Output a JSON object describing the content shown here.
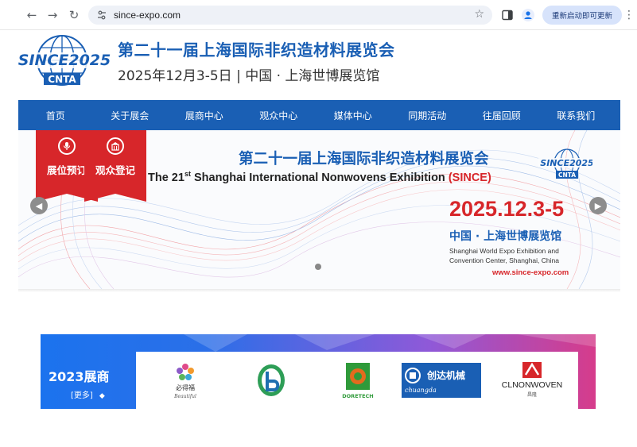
{
  "browser": {
    "url": "since-expo.com",
    "restart_label": "重新启动即可更新"
  },
  "header": {
    "logo_text_top": "SINCE2025",
    "logo_text_bottom": "CNTA",
    "title": "第二十一届上海国际非织造材料展览会",
    "subtitle": "2025年12月3-5日 | 中国 · 上海世博展览馆"
  },
  "nav": {
    "items": [
      {
        "label": "首页"
      },
      {
        "label": "关于展会"
      },
      {
        "label": "展商中心"
      },
      {
        "label": "观众中心"
      },
      {
        "label": "媒体中心"
      },
      {
        "label": "同期活动"
      },
      {
        "label": "往届回顾"
      },
      {
        "label": "联系我们"
      }
    ]
  },
  "banner": {
    "ribbons": [
      {
        "label": "展位预订"
      },
      {
        "label": "观众登记"
      }
    ],
    "title_cn": "第二十一届上海国际非织造材料展览会",
    "title_en_pre": "The 21",
    "title_en_sup": "st",
    "title_en_main": " Shanghai International Nonwovens Exhibition ",
    "title_en_since": "(SINCE)",
    "logo_text": "SINCE2025",
    "logo_sub": "CNTA",
    "date": "2025.12.3-5",
    "venue_cn": "中国 · 上海世博展览馆",
    "venue_en_line1": "Shanghai World Expo Exhibition and",
    "venue_en_line2": "Convention Center, Shanghai, China",
    "url": "www.since-expo.com"
  },
  "exhibitors": {
    "title": "2023展商",
    "more": "[更多]",
    "brands": [
      {
        "name": "Beautiful",
        "cn": "必得福"
      },
      {
        "name": "green-b-logo"
      },
      {
        "name": "DORETECH"
      },
      {
        "name": "chuangda",
        "cn": "创达机械"
      },
      {
        "name": "CLNONWOVEN",
        "cn": "昌隆"
      }
    ]
  },
  "colors": {
    "brand_blue": "#1a5fb4",
    "accent_red": "#d7262a"
  }
}
